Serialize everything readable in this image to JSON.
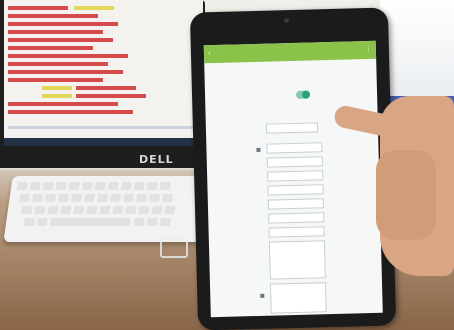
{
  "scene": {
    "monitor_brand": "DELL"
  },
  "tablet": {
    "toggle_state": "on"
  },
  "colors": {
    "tablet_app_bar": "#8bc34a",
    "toggle_on": "#2ea07e",
    "spreadsheet_highlight": "#d64a4a",
    "spreadsheet_yellow": "#e4d65a"
  },
  "icons": {
    "back": "back-icon",
    "menu": "menu-icon"
  }
}
